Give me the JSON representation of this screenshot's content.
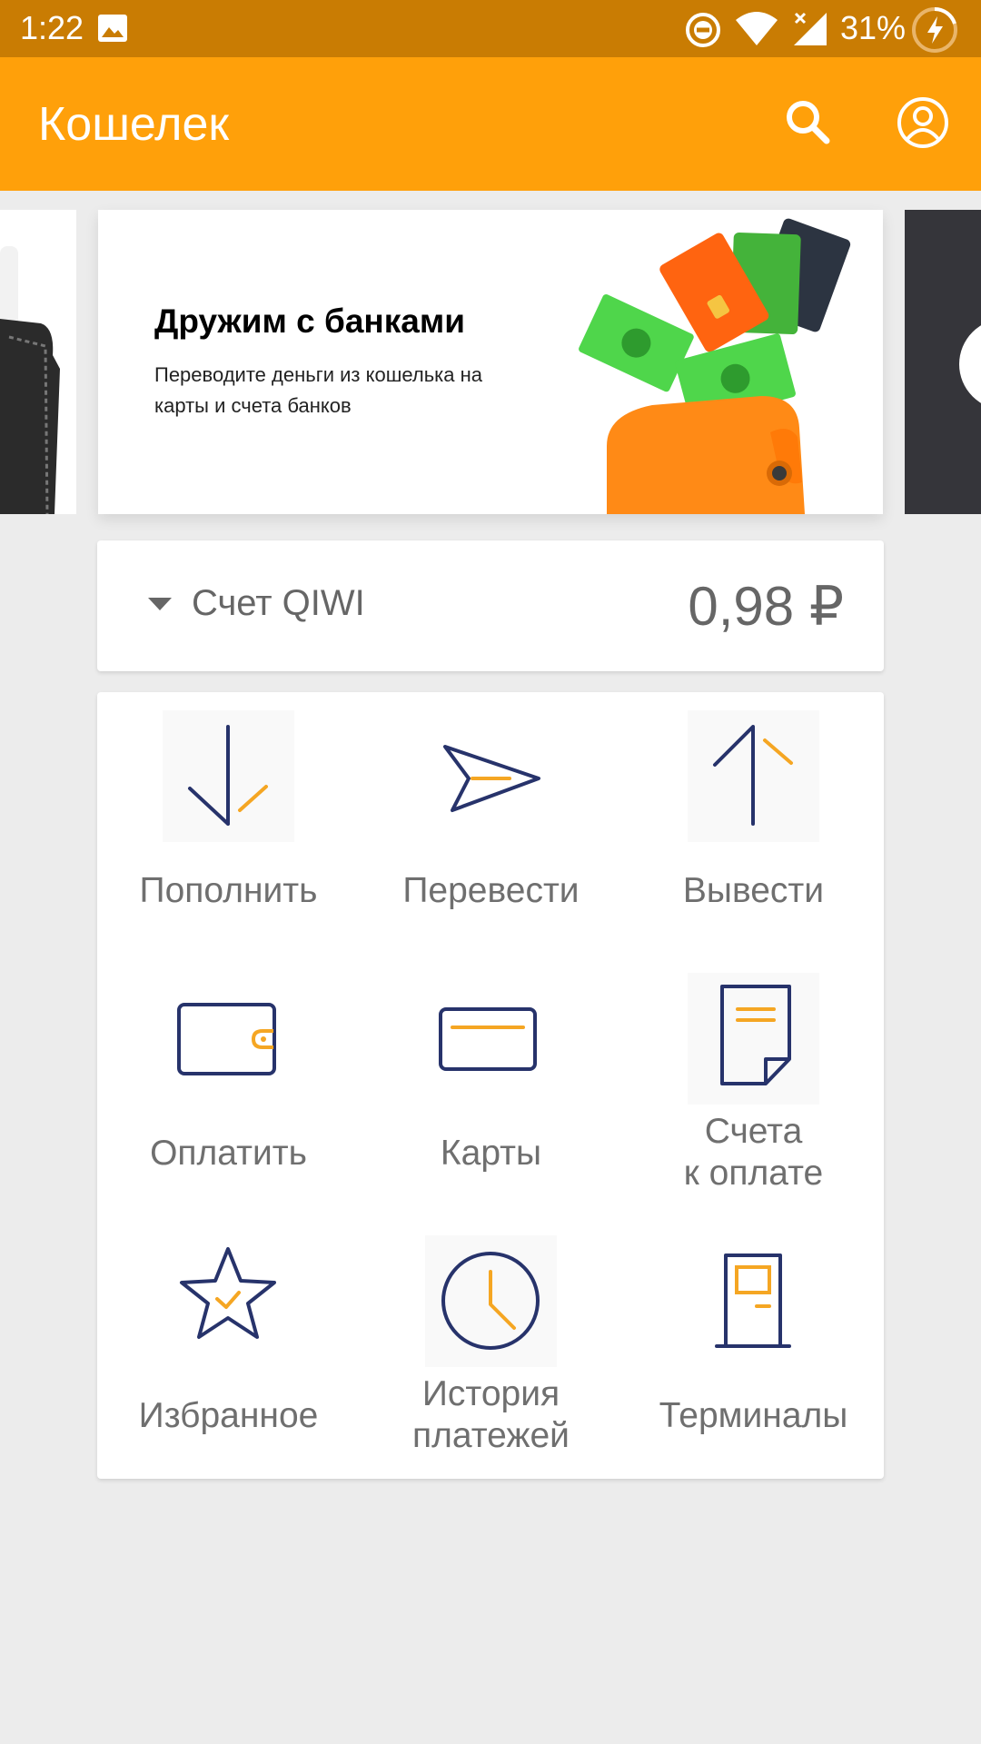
{
  "status_bar": {
    "time": "1:22",
    "battery": "31%",
    "icons": [
      "gallery-icon",
      "dnd-icon",
      "wifi-icon",
      "signal-icon",
      "battery-charging-icon"
    ]
  },
  "app_bar": {
    "title": "Кошелек",
    "icons": [
      "search-icon",
      "profile-icon"
    ]
  },
  "banner": {
    "title": "Дружим с банками",
    "subtitle": "Переводите деньги из кошелька на карты и счета банков"
  },
  "account": {
    "name": "Счет QIWI",
    "balance": "0,98 ₽"
  },
  "actions": [
    {
      "label": "Пополнить",
      "icon": "top-up-icon"
    },
    {
      "label": "Перевести",
      "icon": "transfer-icon"
    },
    {
      "label": "Вывести",
      "icon": "withdraw-icon"
    },
    {
      "label": "Оплатить",
      "icon": "wallet-pay-icon"
    },
    {
      "label": "Карты",
      "icon": "card-icon"
    },
    {
      "label": "Счета\nк оплате",
      "icon": "invoice-icon"
    },
    {
      "label": "Избранное",
      "icon": "star-icon"
    },
    {
      "label": "История\nплатежей",
      "icon": "clock-icon"
    },
    {
      "label": "Терминалы",
      "icon": "terminal-icon"
    }
  ],
  "colors": {
    "status_bar": "#c97c03",
    "app_bar": "#ffa00a",
    "icon_primary": "#27336b",
    "icon_accent": "#f5a623",
    "background": "#ececec"
  }
}
